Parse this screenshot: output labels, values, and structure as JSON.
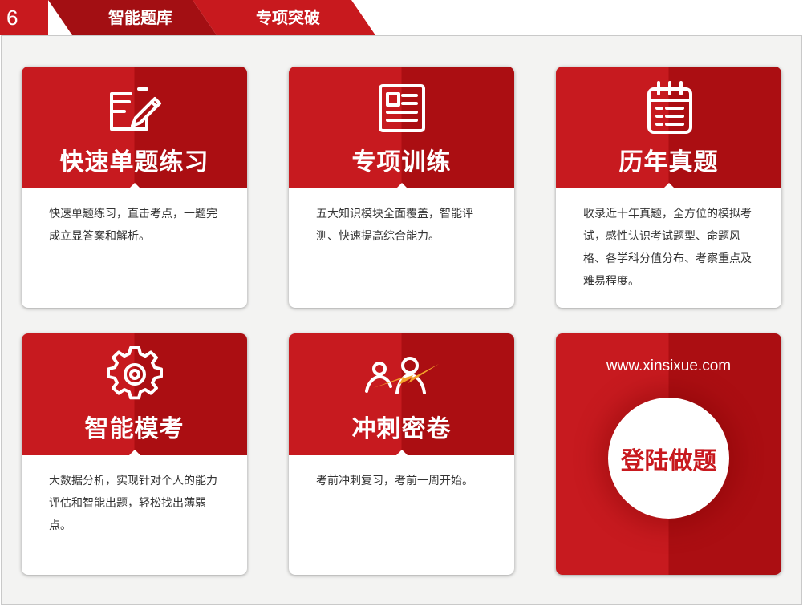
{
  "header": {
    "page_number": "6",
    "crumbs": [
      "智能题库",
      "专项突破"
    ]
  },
  "cards": [
    {
      "icon": "pencil-notepad-icon",
      "title": "快速单题练习",
      "description": "快速单题练习，直击考点，一题完成立显答案和解析。"
    },
    {
      "icon": "document-icon",
      "title": "专项训练",
      "description": "五大知识模块全面覆盖，智能评测、快速提高综合能力。"
    },
    {
      "icon": "calendar-icon",
      "title": "历年真题",
      "description": "收录近十年真题，全方位的模拟考试，感性认识考试题型、命题风格、各学科分值分布、考察重点及难易程度。"
    },
    {
      "icon": "gear-icon",
      "title": "智能模考",
      "description": "大数据分析，实现针对个人的能力评估和智能出题，轻松找出薄弱点。"
    },
    {
      "icon": "sprint-people-icon",
      "title": "冲刺密卷",
      "description": "考前冲刺复习，考前一周开始。"
    }
  ],
  "login": {
    "url": "www.xinsixue.com",
    "button_label": "登陆做题"
  },
  "colors": {
    "primary_red": "#c71a1f",
    "dark_red": "#ab0e12",
    "accent_orange": "#f2a12a"
  }
}
